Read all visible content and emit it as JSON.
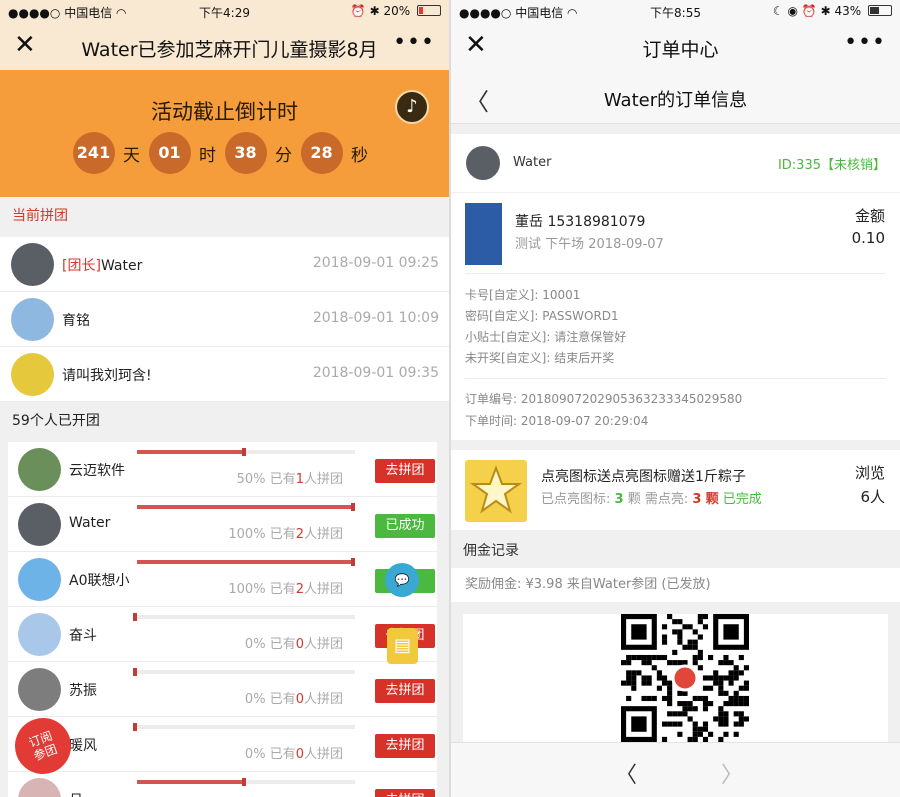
{
  "left": {
    "status": {
      "carrier": "中国电信",
      "time": "下午4:29",
      "battery": "20%",
      "battery_level": 0.2
    },
    "nav": {
      "title": "Water已参加芝麻开门儿童摄影8月"
    },
    "banner": {
      "title": "活动截止倒计时",
      "countdown": [
        {
          "value": "241",
          "unit": "天"
        },
        {
          "value": "01",
          "unit": "时"
        },
        {
          "value": "38",
          "unit": "分"
        },
        {
          "value": "28",
          "unit": "秒"
        }
      ]
    },
    "current_group": {
      "heading": "当前拼团",
      "members": [
        {
          "tag": "[团长]",
          "name": "Water",
          "time": "2018-09-01 09:25",
          "avatar_color": "#5a5f66"
        },
        {
          "tag": "",
          "name": "育铭",
          "time": "2018-09-01 10:09",
          "avatar_color": "#8fb8e0"
        },
        {
          "tag": "",
          "name": "请叫我刘珂含!",
          "time": "2018-09-01 09:35",
          "avatar_color": "#e6c83d"
        }
      ]
    },
    "open_groups": {
      "heading": "59个人已开团",
      "items": [
        {
          "name": "云迈软件",
          "percent": "50%",
          "text_pre": "已有",
          "count": "1",
          "text_post": "人拼团",
          "progress": 0.5,
          "button": "去拼团",
          "done": false,
          "avatar_color": "#6a8f5a"
        },
        {
          "name": "Water",
          "percent": "100%",
          "text_pre": "已有",
          "count": "2",
          "text_post": "人拼团",
          "progress": 1.0,
          "button": "已成功",
          "done": true,
          "avatar_color": "#5a5f66"
        },
        {
          "name": "A0联想小",
          "percent": "100%",
          "text_pre": "已有",
          "count": "2",
          "text_post": "人拼团",
          "progress": 1.0,
          "button": "",
          "done": true,
          "avatar_color": "#6db3e8"
        },
        {
          "name": "奋斗",
          "percent": "0%",
          "text_pre": "已有",
          "count": "0",
          "text_post": "人拼团",
          "progress": 0.0,
          "button": "去拼团",
          "done": false,
          "avatar_color": "#a9c7e8"
        },
        {
          "name": "苏振",
          "percent": "0%",
          "text_pre": "已有",
          "count": "0",
          "text_post": "人拼团",
          "progress": 0.0,
          "button": "去拼团",
          "done": false,
          "avatar_color": "#7d7d7d"
        },
        {
          "name": "暖风",
          "percent": "0%",
          "text_pre": "已有",
          "count": "0",
          "text_post": "人拼团",
          "progress": 0.0,
          "button": "去拼团",
          "done": false,
          "avatar_color": "#c9a98a"
        },
        {
          "name": "月",
          "percent": "",
          "text_pre": "",
          "count": "",
          "text_post": "",
          "progress": 0.5,
          "button": "去拼团",
          "done": false,
          "avatar_color": "#d9b4b4"
        }
      ]
    },
    "floats": {
      "chat": "",
      "doc": "",
      "stamp": "订阅\n参团"
    }
  },
  "right": {
    "status": {
      "carrier": "中国电信",
      "time": "下午8:55",
      "battery": "43%",
      "battery_level": 0.43
    },
    "nav": {
      "title": "订单中心"
    },
    "subnav": {
      "title": "Water的订单信息"
    },
    "header": {
      "username": "Water",
      "order_id": "ID:335【未核销】",
      "avatar_color": "#5a5f66"
    },
    "product": {
      "line1": "董岳 15318981079",
      "line2": "测试 下午场 2018-09-07",
      "amount_label": "金额",
      "amount": "0.10",
      "thumb_color": "#2c5ca6"
    },
    "custom_fields": [
      {
        "label": "卡号[自定义]:",
        "value": "10001"
      },
      {
        "label": "密码[自定义]:",
        "value": "PASSWORD1"
      },
      {
        "label": "小贴士[自定义]:",
        "value": "请注意保管好"
      },
      {
        "label": "未开奖[自定义]:",
        "value": "结束后开奖"
      }
    ],
    "order_info": [
      {
        "label": "订单编号:",
        "value": "20180907202905363233345029580"
      },
      {
        "label": "下单时间:",
        "value": "2018-09-07 20:29:04"
      }
    ],
    "lightup": {
      "title": "点亮图标送点亮图标赠送1斤粽子",
      "lit_label": "已点亮图标:",
      "lit_count": "3",
      "lit_unit": "颗",
      "need_label": "需点亮:",
      "need_count": "3",
      "need_unit": "颗",
      "status": "已完成",
      "views_label": "浏览",
      "views": "6人"
    },
    "commission": {
      "heading": "佣金记录",
      "text": "奖励佣金: ¥3.98 来自Water参团 (已发放)"
    }
  }
}
